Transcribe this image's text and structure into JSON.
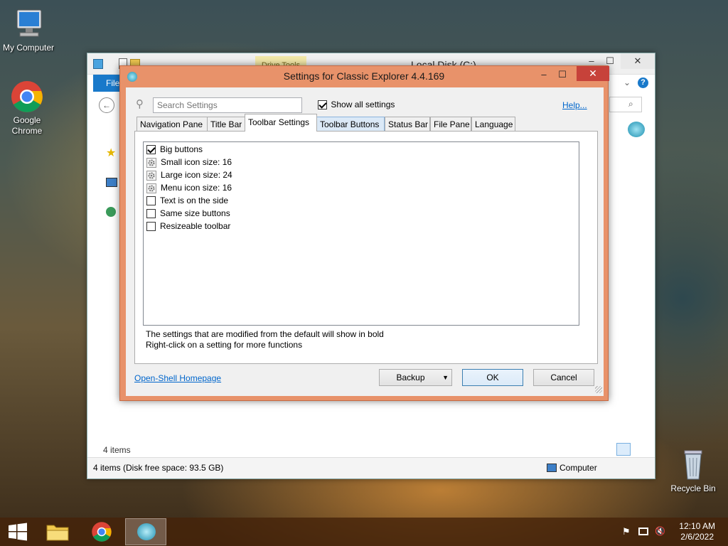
{
  "desktop": {
    "icons": [
      {
        "label": "My Computer"
      },
      {
        "label": "Google Chrome"
      },
      {
        "label": "Recycle Bin"
      }
    ]
  },
  "explorer": {
    "title": "Local Disk (C:)",
    "contextual_tab": "Drive Tools",
    "file_tab": "File",
    "item_count": "4 items",
    "status_text": "4 items (Disk free space: 93.5 GB)",
    "status_location": "Computer"
  },
  "dialog": {
    "title": "Settings for Classic Explorer 4.4.169",
    "search_placeholder": "Search Settings",
    "show_all_label": "Show all settings",
    "show_all_checked": true,
    "help_link": "Help...",
    "tabs": [
      {
        "label": "Navigation Pane"
      },
      {
        "label": "Title Bar"
      },
      {
        "label": "Toolbar Settings",
        "active": true
      },
      {
        "label": "Toolbar Buttons"
      },
      {
        "label": "Status Bar"
      },
      {
        "label": "File Pane"
      },
      {
        "label": "Language"
      }
    ],
    "settings": [
      {
        "label": "Big buttons",
        "kind": "checkbox",
        "checked": true
      },
      {
        "label": "Small icon size: 16",
        "kind": "value"
      },
      {
        "label": "Large icon size: 24",
        "kind": "value"
      },
      {
        "label": "Menu icon size: 16",
        "kind": "value"
      },
      {
        "label": "Text is on the side",
        "kind": "checkbox",
        "checked": false
      },
      {
        "label": "Same size buttons",
        "kind": "checkbox",
        "checked": false
      },
      {
        "label": "Resizeable toolbar",
        "kind": "checkbox",
        "checked": false
      }
    ],
    "hint_line1": "The settings that are modified from the default will show in bold",
    "hint_line2": "Right-click on a setting for more functions",
    "homepage_link": "Open-Shell Homepage",
    "backup_label": "Backup",
    "ok_label": "OK",
    "cancel_label": "Cancel"
  },
  "taskbar": {
    "time": "12:10 AM",
    "date": "2/6/2022"
  },
  "colors": {
    "dialog_frame": "#e8926a",
    "close_red": "#c7423a",
    "file_tab_blue": "#1979ca",
    "link_blue": "#0066cc"
  }
}
